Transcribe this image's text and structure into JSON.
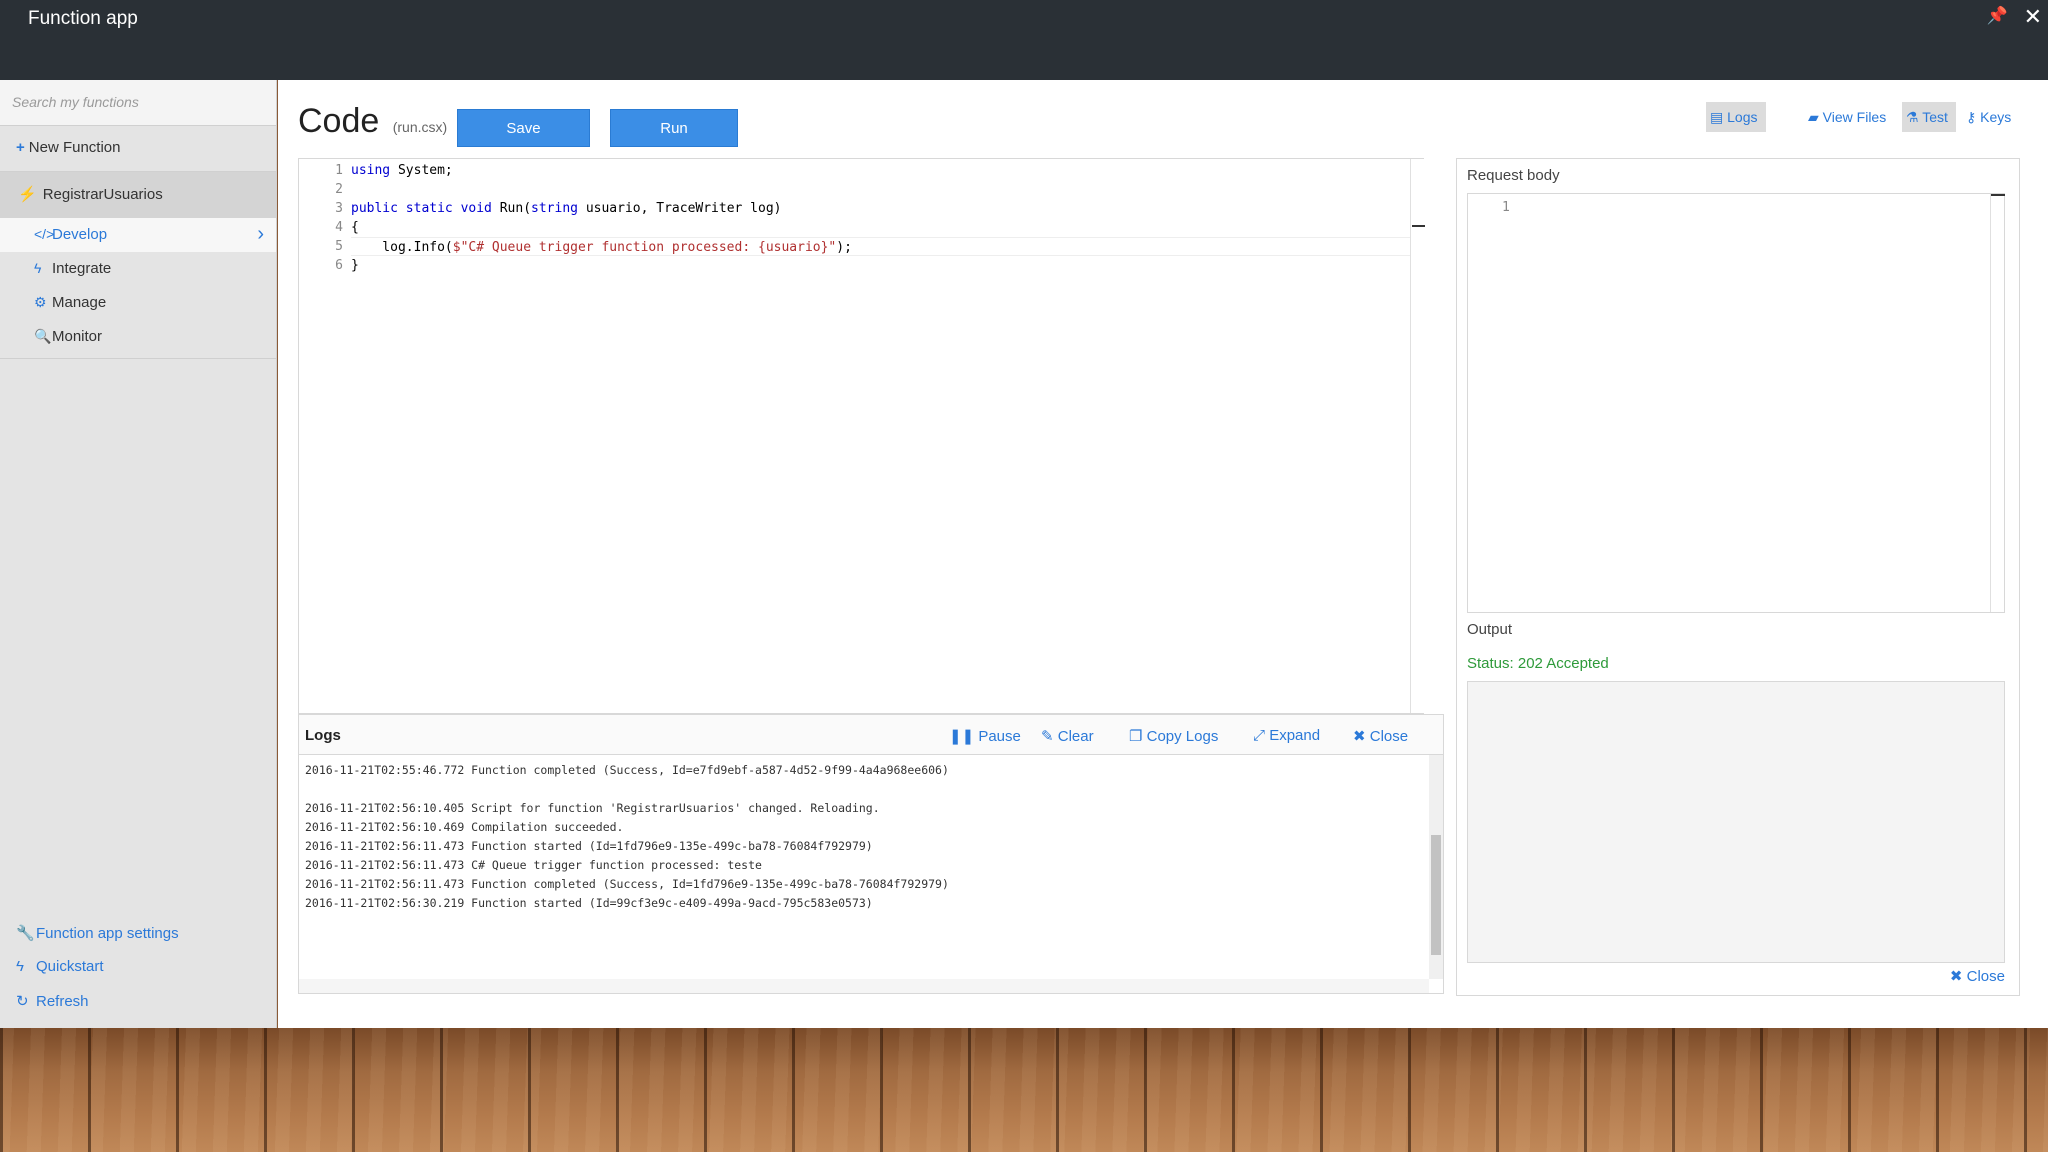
{
  "window": {
    "title": "Function app",
    "pin_glyph": "📌",
    "close_glyph": "✕"
  },
  "sidebar": {
    "search_placeholder": "Search my functions",
    "new_function": "New Function",
    "function_name": "RegistrarUsuarios",
    "items": [
      {
        "label": "Develop",
        "icon": "code-icon",
        "glyph": "</>"
      },
      {
        "label": "Integrate",
        "icon": "bolt-icon",
        "glyph": "ϟ"
      },
      {
        "label": "Manage",
        "icon": "gear-icon",
        "glyph": "⚙"
      },
      {
        "label": "Monitor",
        "icon": "search-icon",
        "glyph": "🔍"
      }
    ],
    "bottom": [
      {
        "label": "Function app settings",
        "icon": "wrench-icon",
        "glyph": "🔧"
      },
      {
        "label": "Quickstart",
        "icon": "bolt-icon",
        "glyph": "ϟ"
      },
      {
        "label": "Refresh",
        "icon": "refresh-icon",
        "glyph": "↻"
      }
    ]
  },
  "header": {
    "title": "Code",
    "file": "(run.csx)",
    "save_label": "Save",
    "run_label": "Run",
    "tools": {
      "logs": "Logs",
      "view_files": "View Files",
      "test": "Test",
      "keys": "Keys"
    }
  },
  "editor": {
    "line_numbers": [
      "1",
      "2",
      "3",
      "4",
      "5",
      "6"
    ],
    "lines": {
      "l1_kw": "using",
      "l1_rest": " System;",
      "l3_kw1": "public static void",
      "l3_mid": " Run(",
      "l3_kw2": "string",
      "l3_rest": " usuario, TraceWriter log)",
      "l4": "{",
      "l5_pre": "    log.Info(",
      "l5_str": "$\"C# Queue trigger function processed: {usuario}\"",
      "l5_post": ");",
      "l6": "}"
    }
  },
  "logs": {
    "label": "Logs",
    "pause": "Pause",
    "clear": "Clear",
    "copy": "Copy Logs",
    "expand": "Expand",
    "close": "Close",
    "lines": [
      "2016-11-21T02:55:46.772 Function completed (Success, Id=e7fd9ebf-a587-4d52-9f99-4a4a968ee606)",
      "",
      "2016-11-21T02:56:10.405 Script for function 'RegistrarUsuarios' changed. Reloading.",
      "2016-11-21T02:56:10.469 Compilation succeeded.",
      "2016-11-21T02:56:11.473 Function started (Id=1fd796e9-135e-499c-ba78-76084f792979)",
      "2016-11-21T02:56:11.473 C# Queue trigger function processed: teste",
      "2016-11-21T02:56:11.473 Function completed (Success, Id=1fd796e9-135e-499c-ba78-76084f792979)",
      "2016-11-21T02:56:30.219 Function started (Id=99cf3e9c-e409-499a-9acd-795c583e0573)"
    ]
  },
  "test_panel": {
    "request_body_label": "Request body",
    "request_line_number": "1",
    "output_label": "Output",
    "status": "Status: 202 Accepted",
    "close": "Close"
  },
  "colors": {
    "accent": "#2b79d8",
    "button": "#3b8ee6",
    "titlebar": "#2a3036",
    "status_ok": "#2e9a3a"
  }
}
